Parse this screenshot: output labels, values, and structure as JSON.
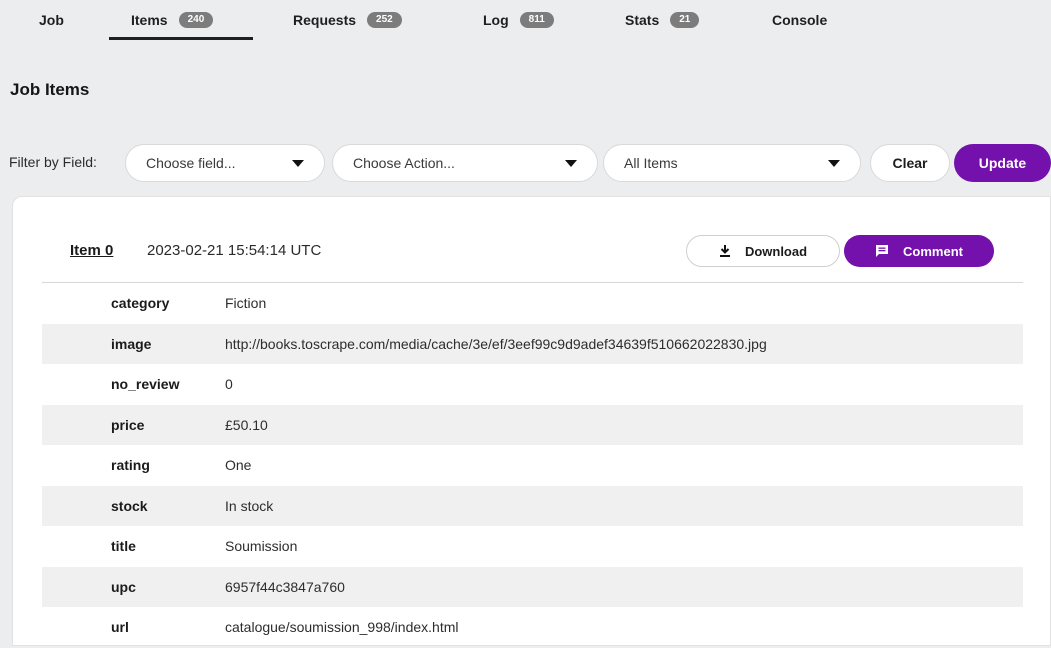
{
  "tabs": [
    {
      "label": "Job",
      "badge": ""
    },
    {
      "label": "Items",
      "badge": "240"
    },
    {
      "label": "Requests",
      "badge": "252"
    },
    {
      "label": "Log",
      "badge": "811"
    },
    {
      "label": "Stats",
      "badge": "21"
    },
    {
      "label": "Console",
      "badge": ""
    }
  ],
  "active_tab": "Items",
  "page_title": "Job Items",
  "filter": {
    "label": "Filter by Field:",
    "field_select": "Choose field...",
    "action_select": "Choose Action...",
    "items_select": "All Items",
    "clear_label": "Clear",
    "update_label": "Update"
  },
  "item": {
    "link_label": "Item 0",
    "timestamp": "2023-02-21 15:54:14 UTC",
    "download_label": "Download",
    "comment_label": "Comment",
    "fields": [
      {
        "key": "category",
        "value": "Fiction"
      },
      {
        "key": "image",
        "value": "http://books.toscrape.com/media/cache/3e/ef/3eef99c9d9adef34639f510662022830.jpg"
      },
      {
        "key": "no_review",
        "value": "0"
      },
      {
        "key": "price",
        "value": "£50.10"
      },
      {
        "key": "rating",
        "value": "One"
      },
      {
        "key": "stock",
        "value": "In stock"
      },
      {
        "key": "title",
        "value": "Soumission"
      },
      {
        "key": "upc",
        "value": "6957f44c3847a760"
      },
      {
        "key": "url",
        "value": "catalogue/soumission_998/index.html"
      }
    ]
  },
  "colors": {
    "accent": "#7410ab",
    "badge": "#7c7c7c",
    "background": "#ebedef"
  },
  "icons": {
    "download": "download-icon",
    "comment": "comment-icon",
    "caret": "caret-down-icon"
  }
}
